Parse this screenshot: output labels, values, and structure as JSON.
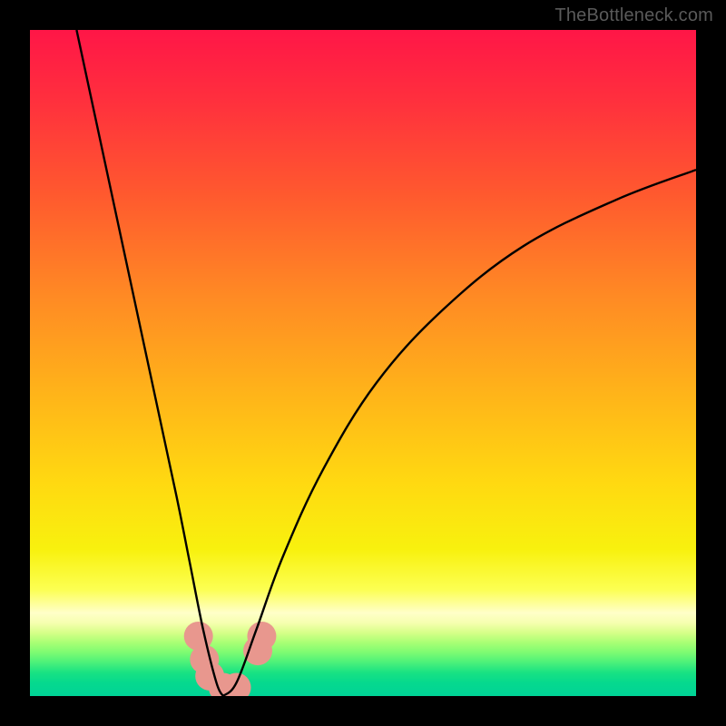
{
  "watermark": "TheBottleneck.com",
  "colors": {
    "frame": "#000000",
    "curve": "#000000",
    "marker": "#e8978e",
    "gradient_stops": [
      {
        "offset": 0.0,
        "color": "#ff1647"
      },
      {
        "offset": 0.1,
        "color": "#ff2e3e"
      },
      {
        "offset": 0.25,
        "color": "#ff5a2e"
      },
      {
        "offset": 0.4,
        "color": "#ff8a24"
      },
      {
        "offset": 0.55,
        "color": "#ffb519"
      },
      {
        "offset": 0.68,
        "color": "#ffd911"
      },
      {
        "offset": 0.78,
        "color": "#f8f10e"
      },
      {
        "offset": 0.84,
        "color": "#fcff52"
      },
      {
        "offset": 0.875,
        "color": "#ffffc8"
      },
      {
        "offset": 0.89,
        "color": "#f6ffb0"
      },
      {
        "offset": 0.905,
        "color": "#d6ff88"
      },
      {
        "offset": 0.92,
        "color": "#a8ff74"
      },
      {
        "offset": 0.935,
        "color": "#7cfb72"
      },
      {
        "offset": 0.95,
        "color": "#4af07a"
      },
      {
        "offset": 0.965,
        "color": "#18e283"
      },
      {
        "offset": 0.98,
        "color": "#06d98e"
      },
      {
        "offset": 1.0,
        "color": "#00d396"
      }
    ]
  },
  "chart_data": {
    "type": "line",
    "title": "",
    "xlabel": "",
    "ylabel": "",
    "x_range": [
      0,
      100
    ],
    "y_range": [
      0,
      100
    ],
    "optimum_x": 29,
    "series": [
      {
        "name": "left-branch",
        "points": [
          {
            "x": 7.0,
            "y": 100.0
          },
          {
            "x": 10.0,
            "y": 86.0
          },
          {
            "x": 13.0,
            "y": 72.0
          },
          {
            "x": 16.0,
            "y": 58.0
          },
          {
            "x": 19.0,
            "y": 44.0
          },
          {
            "x": 22.0,
            "y": 30.0
          },
          {
            "x": 24.0,
            "y": 20.0
          },
          {
            "x": 26.0,
            "y": 10.0
          },
          {
            "x": 28.0,
            "y": 2.0
          },
          {
            "x": 29.0,
            "y": 0.0
          }
        ]
      },
      {
        "name": "right-branch",
        "points": [
          {
            "x": 29.0,
            "y": 0.0
          },
          {
            "x": 31.0,
            "y": 2.0
          },
          {
            "x": 34.0,
            "y": 10.0
          },
          {
            "x": 38.0,
            "y": 21.0
          },
          {
            "x": 44.0,
            "y": 34.0
          },
          {
            "x": 52.0,
            "y": 47.0
          },
          {
            "x": 62.0,
            "y": 58.0
          },
          {
            "x": 74.0,
            "y": 67.5
          },
          {
            "x": 88.0,
            "y": 74.5
          },
          {
            "x": 100.0,
            "y": 79.0
          }
        ]
      }
    ],
    "markers": [
      {
        "x": 25.3,
        "y": 9.0
      },
      {
        "x": 26.2,
        "y": 5.5
      },
      {
        "x": 27.0,
        "y": 3.0
      },
      {
        "x": 29.0,
        "y": 1.3
      },
      {
        "x": 31.0,
        "y": 1.3
      },
      {
        "x": 34.2,
        "y": 6.8
      },
      {
        "x": 34.8,
        "y": 9.0
      }
    ],
    "marker_radius": 16
  }
}
